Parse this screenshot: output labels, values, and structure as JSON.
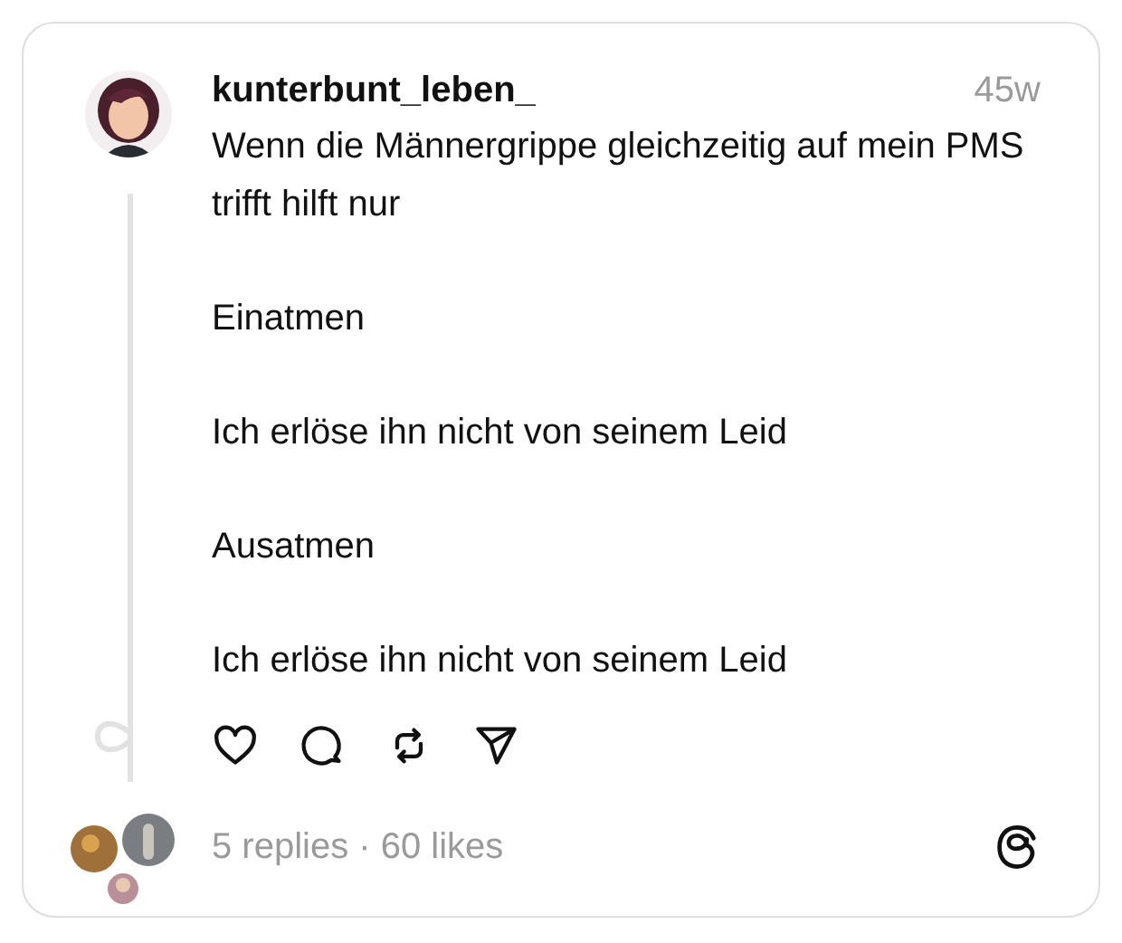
{
  "post": {
    "username": "kunterbunt_leben_",
    "time": "45w",
    "paragraphs": [
      "Wenn die Männergrippe gleichzeitig auf mein PMS trifft hilft nur",
      "Einatmen",
      "Ich erlöse ihn nicht von seinem Leid",
      "Ausatmen",
      "Ich erlöse ihn nicht von seinem Leid"
    ]
  },
  "footer": {
    "stats": "5 replies · 60 likes"
  }
}
